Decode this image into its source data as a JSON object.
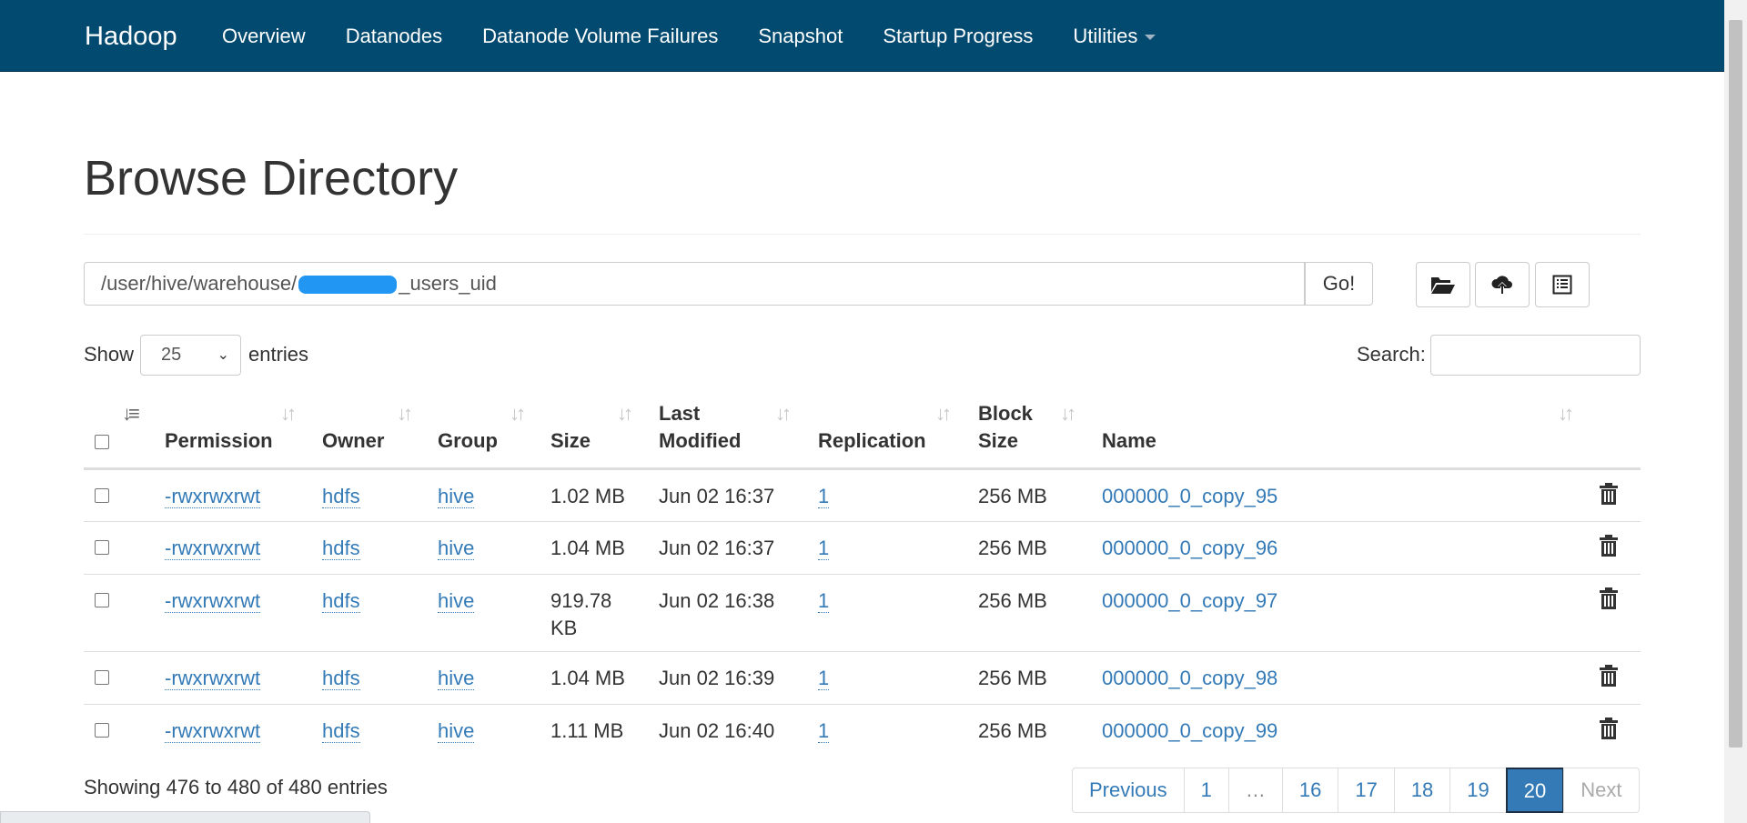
{
  "navbar": {
    "brand": "Hadoop",
    "items": [
      "Overview",
      "Datanodes",
      "Datanode Volume Failures",
      "Snapshot",
      "Startup Progress",
      "Utilities"
    ]
  },
  "page": {
    "title": "Browse Directory"
  },
  "path_bar": {
    "path_prefix": "/user/hive/warehouse/",
    "path_suffix": "_users_uid",
    "go_label": "Go!"
  },
  "tools": [
    "folder-open-icon",
    "cloud-upload-icon",
    "list-alt-icon"
  ],
  "controls": {
    "show_label": "Show",
    "entries_value": "25",
    "entries_label": "entries",
    "search_label": "Search:",
    "search_value": ""
  },
  "table": {
    "headers": {
      "permission": "Permission",
      "owner": "Owner",
      "group": "Group",
      "size": "Size",
      "last_modified_1": "Last",
      "last_modified_2": "Modified",
      "replication": "Replication",
      "block_size_1": "Block",
      "block_size_2": "Size",
      "name": "Name"
    },
    "rows": [
      {
        "permission": "-rwxrwxrwt",
        "owner": "hdfs",
        "group": "hive",
        "size": "1.02 MB",
        "size_unit": "",
        "last_modified": "Jun 02 16:37",
        "replication": "1",
        "block_size": "256 MB",
        "name": "000000_0_copy_95"
      },
      {
        "permission": "-rwxrwxrwt",
        "owner": "hdfs",
        "group": "hive",
        "size": "1.04 MB",
        "size_unit": "",
        "last_modified": "Jun 02 16:37",
        "replication": "1",
        "block_size": "256 MB",
        "name": "000000_0_copy_96"
      },
      {
        "permission": "-rwxrwxrwt",
        "owner": "hdfs",
        "group": "hive",
        "size": "919.78",
        "size_unit": "KB",
        "last_modified": "Jun 02 16:38",
        "replication": "1",
        "block_size": "256 MB",
        "name": "000000_0_copy_97"
      },
      {
        "permission": "-rwxrwxrwt",
        "owner": "hdfs",
        "group": "hive",
        "size": "1.04 MB",
        "size_unit": "",
        "last_modified": "Jun 02 16:39",
        "replication": "1",
        "block_size": "256 MB",
        "name": "000000_0_copy_98"
      },
      {
        "permission": "-rwxrwxrwt",
        "owner": "hdfs",
        "group": "hive",
        "size": "1.11 MB",
        "size_unit": "",
        "last_modified": "Jun 02 16:40",
        "replication": "1",
        "block_size": "256 MB",
        "name": "000000_0_copy_99"
      }
    ]
  },
  "footer": {
    "info": "Showing 476 to 480 of 480 entries",
    "pagination": {
      "previous": "Previous",
      "pages": [
        "1",
        "…",
        "16",
        "17",
        "18",
        "19",
        "20"
      ],
      "current": "20",
      "next": "Next"
    }
  },
  "colors": {
    "navbar": "#024a70",
    "link": "#337ab7",
    "active_page": "#337ab7",
    "redaction": "#2196f3"
  }
}
